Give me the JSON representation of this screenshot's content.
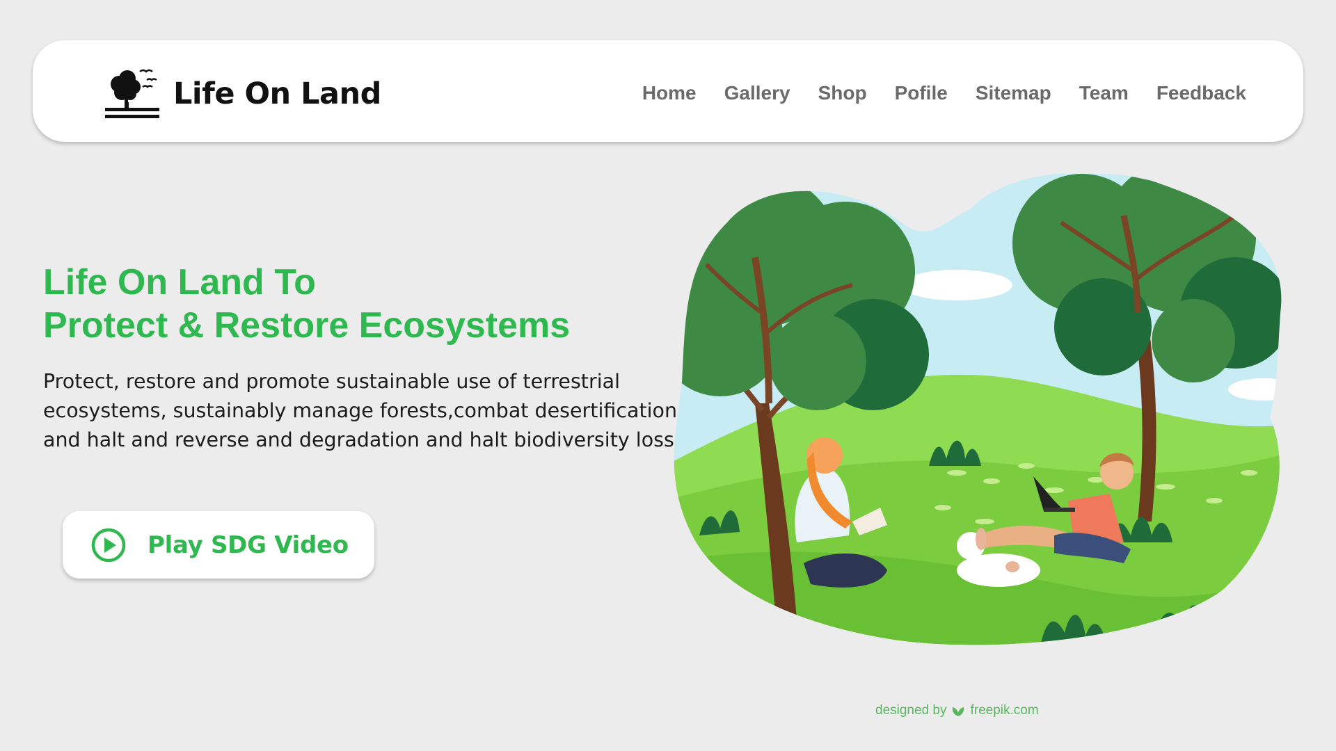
{
  "brand": {
    "name": "Life On Land",
    "logo_icon": "tree-birds-logo"
  },
  "nav": {
    "items": [
      {
        "label": "Home"
      },
      {
        "label": "Gallery"
      },
      {
        "label": "Shop"
      },
      {
        "label": "Pofile"
      },
      {
        "label": "Sitemap"
      },
      {
        "label": "Team"
      },
      {
        "label": "Feedback"
      }
    ]
  },
  "hero": {
    "title_line1": "Life On Land To",
    "title_line2": "Protect & Restore Ecosystems",
    "desc_line1": "Protect, restore and promote sustainable use  of terrestrial",
    "desc_line2": "ecosystems, sustainably manage forests,combat desertification,",
    "desc_line3": "and halt and reverse and degradation and halt biodiversity loss"
  },
  "cta": {
    "label": "Play SDG Video",
    "icon": "play-circle-icon"
  },
  "illustration": {
    "credit_prefix": "designed by",
    "credit_brand": "freepik.com"
  },
  "colors": {
    "accent": "#2fb84f",
    "nav_text": "#6a6a6a",
    "background": "#ececec"
  }
}
